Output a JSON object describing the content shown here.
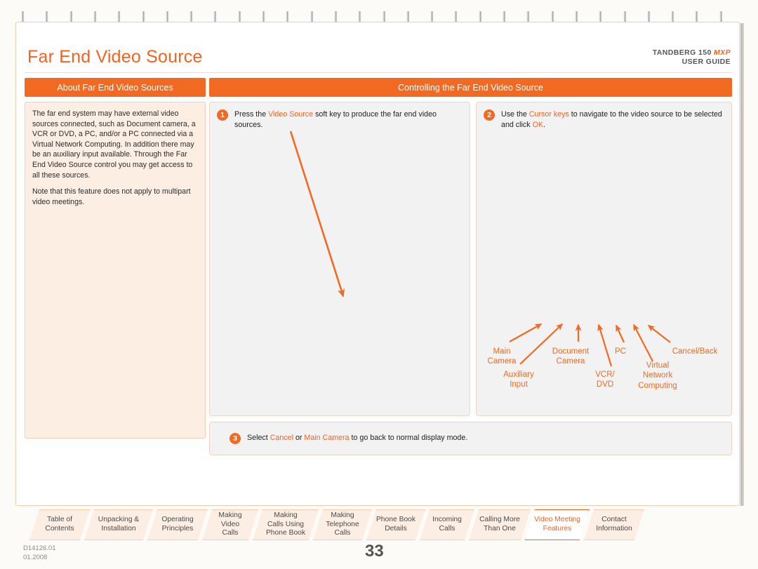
{
  "document": {
    "title": "Far End Video Source",
    "brand_product": "TANDBERG 150 ",
    "brand_mxp": "MXP",
    "brand_guide": "USER GUIDE",
    "doc_id": "D14126.01\n01.2008",
    "page_number": "33"
  },
  "sections": {
    "left_bar": "About Far End Video Sources",
    "right_bar": "Controlling the Far End Video Source"
  },
  "about": {
    "paragraph1": "The far end system may have external video sources connected, such as Document camera, a VCR or DVD, a PC, and/or a PC connected via a Virtual Network Computing. In addition there may be an auxiliary input available. Through the Far End Video Source control you may get access to all these sources.",
    "paragraph2": "Note that this feature does not apply to multipart video meetings."
  },
  "steps": [
    {
      "number": "1",
      "text_parts": [
        "Press the ",
        "Video Source",
        " soft key to produce the far end video sources."
      ],
      "pre": "Press the ",
      "highlight": "Video Source",
      "post": " soft key to produce the far end video sources."
    },
    {
      "number": "2",
      "pre": "Use the ",
      "highlight": "Cursor keys",
      "mid": " to navigate to the video source to be selected and click ",
      "highlight2": "OK",
      "post": "."
    },
    {
      "number": "3",
      "pre": "Select ",
      "highlight": "Cancel",
      "mid": " or ",
      "highlight2": "Main Camera",
      "post": " to go back to normal display mode."
    }
  ],
  "callouts": [
    {
      "label": "Main\nCamera"
    },
    {
      "label": "Auxiliary\nInput"
    },
    {
      "label": "Document\nCamera"
    },
    {
      "label": "VCR/\nDVD"
    },
    {
      "label": "PC"
    },
    {
      "label": "Virtual\nNetwork\nComputing"
    },
    {
      "label": "Cancel/Back"
    }
  ],
  "tabs": [
    {
      "label": "Table of\nContents",
      "active": false
    },
    {
      "label": "Unpacking &\nInstallation",
      "active": false
    },
    {
      "label": "Operating\nPrinciples",
      "active": false
    },
    {
      "label": "Making\nVideo\nCalls",
      "active": false
    },
    {
      "label": "Making\nCalls Using\nPhone Book",
      "active": false
    },
    {
      "label": "Making\nTelephone\nCalls",
      "active": false
    },
    {
      "label": "Phone Book\nDetails",
      "active": false
    },
    {
      "label": "Incoming\nCalls",
      "active": false
    },
    {
      "label": "Calling More\nThan One",
      "active": false
    },
    {
      "label": "Video Meeting\nFeatures",
      "active": true
    },
    {
      "label": "Contact\nInformation",
      "active": false
    }
  ],
  "colors": {
    "accent": "#f26322",
    "bar": "#f26a21",
    "panel_bg": "#f2f2f2",
    "about_bg": "#fdeee4",
    "page_bg": "#ffffff"
  }
}
